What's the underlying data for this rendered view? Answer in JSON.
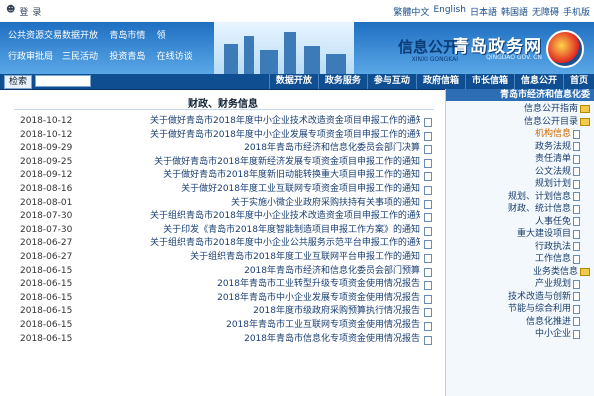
{
  "utility": {
    "right": [
      "繁體中文",
      "English",
      "日本語",
      "韩国語",
      "无障碍",
      "手机版"
    ],
    "left": [
      "登",
      "录"
    ]
  },
  "banner": {
    "brand": "青岛政务网",
    "brand_sub": "QINGDAO GOV. CN",
    "slogan": "信息公开",
    "slogan_sub": "XINXI GONGKAI",
    "links": [
      "公共资源交易",
      "数据开放",
      "青岛市情",
      "领",
      "行政审批局",
      "三民活动",
      "投资青岛",
      "在线访谈"
    ]
  },
  "nav": {
    "items": [
      "首页",
      "信息公开",
      "市长信箱",
      "政府信箱",
      "参与互动",
      "政务服务",
      "数据开放"
    ],
    "search_button": "检索",
    "search_placeholder": ""
  },
  "sidebar": {
    "header": "青岛市经济和信息化委",
    "nodes": [
      {
        "label": "信息公开指南",
        "level": 1,
        "type": "folder"
      },
      {
        "label": "信息公开目录",
        "level": 1,
        "type": "folder"
      },
      {
        "label": "机构信息",
        "level": 2,
        "type": "page",
        "active": true
      },
      {
        "label": "政务法规",
        "level": 2,
        "type": "page"
      },
      {
        "label": "责任清单",
        "level": 2,
        "type": "page"
      },
      {
        "label": "公文法规",
        "level": 2,
        "type": "page"
      },
      {
        "label": "规划计划",
        "level": 2,
        "type": "page"
      },
      {
        "label": "规划、计划信息",
        "level": 2,
        "type": "page"
      },
      {
        "label": "财政、统计信息",
        "level": 2,
        "type": "page"
      },
      {
        "label": "人事任免",
        "level": 2,
        "type": "page"
      },
      {
        "label": "重大建设项目",
        "level": 2,
        "type": "page"
      },
      {
        "label": "行政执法",
        "level": 2,
        "type": "page"
      },
      {
        "label": "工作信息",
        "level": 2,
        "type": "page"
      },
      {
        "label": "业务类信息",
        "level": 1,
        "type": "folder"
      },
      {
        "label": "产业规划",
        "level": 2,
        "type": "page"
      },
      {
        "label": "技术改造与创新",
        "level": 2,
        "type": "page"
      },
      {
        "label": "节能与综合利用",
        "level": 2,
        "type": "page"
      },
      {
        "label": "信息化推进",
        "level": 2,
        "type": "page"
      },
      {
        "label": "中小企业",
        "level": 2,
        "type": "page"
      }
    ]
  },
  "content": {
    "title": "财政、财务信息",
    "rows": [
      {
        "text": "关于做好青岛市2018年度中小企业技术改造资金项目申报工作的通知",
        "date": "2018-10-12"
      },
      {
        "text": "关于做好青岛市2018年度中小企业发展专项资金项目申报工作的通知",
        "date": "2018-10-12"
      },
      {
        "text": "2018年青岛市经济和信息化委员会部门决算",
        "date": "2018-09-29"
      },
      {
        "text": "关于做好青岛市2018年度新经济发展专项资金项目申报工作的通知",
        "date": "2018-09-25"
      },
      {
        "text": "关于做好青岛市2018年度新旧动能转换重大项目申报工作的通知",
        "date": "2018-09-12"
      },
      {
        "text": "关于做好2018年度工业互联网专项资金项目申报工作的通知",
        "date": "2018-08-16"
      },
      {
        "text": "关于实施小微企业政府采购扶持有关事项的通知",
        "date": "2018-08-01"
      },
      {
        "text": "关于组织青岛市2018年度中小企业技术改造资金项目申报工作的通知",
        "date": "2018-07-30"
      },
      {
        "text": "关于印发《青岛市2018年度智能制造项目申报工作方案》的通知",
        "date": "2018-07-30"
      },
      {
        "text": "关于组织青岛市2018年度中小企业公共服务示范平台申报工作的通知",
        "date": "2018-06-27"
      },
      {
        "text": "关于组织青岛市2018年度工业互联网平台申报工作的通知",
        "date": "2018-06-27"
      },
      {
        "text": "2018年青岛市经济和信息化委员会部门预算",
        "date": "2018-06-15"
      },
      {
        "text": "2018年青岛市工业转型升级专项资金使用情况报告",
        "date": "2018-06-15"
      },
      {
        "text": "2018年青岛市中小企业发展专项资金使用情况报告",
        "date": "2018-06-15"
      },
      {
        "text": "2018年度市级政府采购预算执行情况报告",
        "date": "2018-06-15"
      },
      {
        "text": "2018年青岛市工业互联网专项资金使用情况报告",
        "date": "2018-06-15"
      },
      {
        "text": "2018年青岛市信息化专项资金使用情况报告",
        "date": "2018-06-15"
      }
    ]
  }
}
